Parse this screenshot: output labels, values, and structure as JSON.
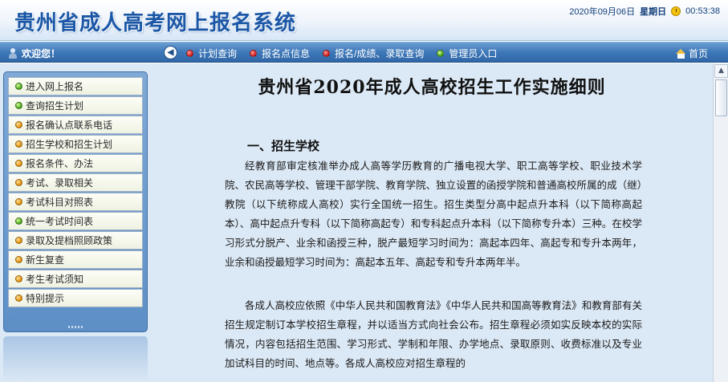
{
  "header": {
    "title": "贵州省成人高考网上报名系统",
    "date": "2020年09月06日",
    "weekday": "星期日",
    "time": "00:53:38"
  },
  "nav": {
    "welcome": "欢迎您！",
    "links": [
      {
        "label": "计划查询",
        "dot": "red"
      },
      {
        "label": "报名点信息",
        "dot": "red"
      },
      {
        "label": "报名/成绩、录取查询",
        "dot": "red"
      },
      {
        "label": "管理员入口",
        "dot": "green"
      }
    ],
    "home_label": "首页"
  },
  "sidebar": {
    "items": [
      {
        "label": "进入网上报名",
        "dot": "green"
      },
      {
        "label": "查询招生计划",
        "dot": "green"
      },
      {
        "label": "报名确认点联系电话",
        "dot": "orange"
      },
      {
        "label": "招生学校和招生计划",
        "dot": "orange"
      },
      {
        "label": "报名条件、办法",
        "dot": "orange"
      },
      {
        "label": "考试、录取相关",
        "dot": "orange"
      },
      {
        "label": "考试科目对照表",
        "dot": "orange"
      },
      {
        "label": "统一考试时间表",
        "dot": "green"
      },
      {
        "label": "录取及提档照顾政策",
        "dot": "orange"
      },
      {
        "label": "新生复查",
        "dot": "orange"
      },
      {
        "label": "考生考试须知",
        "dot": "orange"
      },
      {
        "label": "特别提示",
        "dot": "orange"
      }
    ]
  },
  "content": {
    "title": "贵州省2020年成人高校招生工作实施细则",
    "section1_heading": "一、招生学校",
    "paragraph1": "经教育部审定核准举办成人高等学历教育的广播电视大学、职工高等学校、职业技术学院、农民高等学校、管理干部学院、教育学院、独立设置的函授学院和普通高校所属的成（继）教院（以下统称成人高校）实行全国统一招生。招生类型分高中起点升本科（以下简称高起本）、高中起点升专科（以下简称高起专）和专科起点升本科（以下简称专升本）三种。在校学习形式分脱产、业余和函授三种，脱产最短学习时间为：高起本四年、高起专和专升本两年，业余和函授最短学习时间为：高起本五年、高起专和专升本两年半。",
    "paragraph2": "各成人高校应依照《中华人民共和国教育法》《中华人民共和国高等教育法》和教育部有关招生规定制订本学校招生章程，并以适当方式向社会公布。招生章程必须如实反映本校的实际情况，内容包括招生范围、学习形式、学制和年限、办学地点、录取原则、收费标准以及专业加试科目的时间、地点等。各成人高校应对招生章程的"
  }
}
